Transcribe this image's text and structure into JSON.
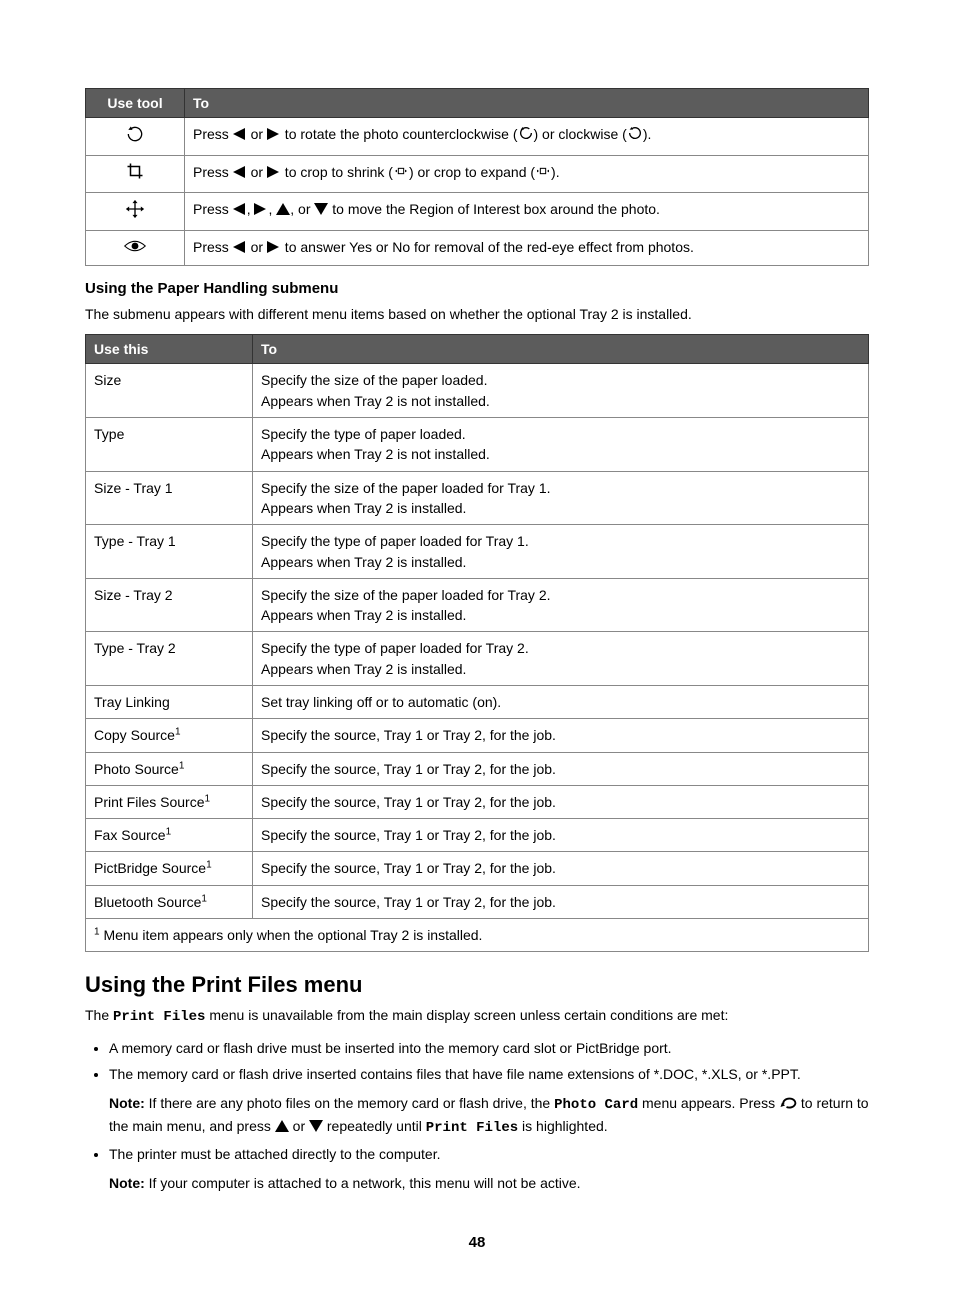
{
  "table1": {
    "head": {
      "tool": "Use tool",
      "to": "To"
    },
    "rows": [
      {
        "icon": "rotate-icon",
        "pre": "Press ",
        "mid1": " or ",
        "text1": " to rotate the photo counterclockwise (",
        "text2": ") or clockwise (",
        "text3": ")."
      },
      {
        "icon": "crop-icon",
        "pre": "Press ",
        "mid1": " or ",
        "text1": " to crop to shrink (",
        "text2": ") or crop to expand (",
        "text3": ")."
      },
      {
        "icon": "move-icon",
        "pre": "Press ",
        "c1": ", ",
        "c2": ", ",
        "c3": ", or ",
        "text1": " to move the Region of Interest box around the photo."
      },
      {
        "icon": "redeye-icon",
        "pre": "Press ",
        "mid1": " or ",
        "text1": " to answer Yes or No for removal of the red-eye effect from photos."
      }
    ]
  },
  "subheading": "Using the Paper Handling submenu",
  "subpara": "The submenu appears with different menu items based on whether the optional Tray 2 is installed.",
  "table2": {
    "head": {
      "usethis": "Use this",
      "to": "To"
    },
    "rows": [
      {
        "name": "Size",
        "sup": "",
        "to": "Specify the size of the paper loaded.\nAppears when Tray 2 is not installed."
      },
      {
        "name": "Type",
        "sup": "",
        "to": "Specify the type of paper loaded.\nAppears when Tray 2 is not installed."
      },
      {
        "name": "Size - Tray 1",
        "sup": "",
        "to": "Specify the size of the paper loaded for Tray 1.\nAppears when Tray 2 is installed."
      },
      {
        "name": "Type - Tray 1",
        "sup": "",
        "to": "Specify the type of paper loaded for Tray 1.\nAppears when Tray 2 is installed."
      },
      {
        "name": "Size - Tray 2",
        "sup": "",
        "to": "Specify the size of the paper loaded for Tray 2.\nAppears when Tray 2 is installed."
      },
      {
        "name": "Type - Tray 2",
        "sup": "",
        "to": "Specify the type of paper loaded for Tray 2.\nAppears when Tray 2 is installed."
      },
      {
        "name": "Tray Linking",
        "sup": "",
        "to": "Set tray linking off or to automatic (on)."
      },
      {
        "name": "Copy Source",
        "sup": "1",
        "to": "Specify the source, Tray 1 or Tray 2, for the job."
      },
      {
        "name": "Photo Source",
        "sup": "1",
        "to": "Specify the source, Tray 1 or Tray 2, for the job."
      },
      {
        "name": "Print Files Source",
        "sup": "1",
        "to": "Specify the source, Tray 1 or Tray 2, for the job."
      },
      {
        "name": "Fax Source",
        "sup": "1",
        "to": "Specify the source, Tray 1 or Tray 2, for the job."
      },
      {
        "name": "PictBridge Source",
        "sup": "1",
        "to": "Specify the source, Tray 1 or Tray 2, for the job."
      },
      {
        "name": "Bluetooth Source",
        "sup": "1",
        "to": "Specify the source, Tray 1 or Tray 2, for the job."
      }
    ],
    "footnote_sup": "1",
    "footnote": " Menu item appears only when the optional Tray 2 is installed."
  },
  "h2": "Using the Print Files menu",
  "intro_pre": "The ",
  "intro_mono": "Print Files",
  "intro_post": " menu is unavailable from the main display screen unless certain conditions are met:",
  "bullets": {
    "b1": "A memory card or flash drive must be inserted into the memory card slot or PictBridge port.",
    "b2": "The memory card or flash drive inserted contains files that have file name extensions of *.DOC, *.XLS, or *.PPT.",
    "note1_label": "Note: ",
    "note1_a": "If there are any photo files on the memory card or flash drive, the ",
    "note1_mono": "Photo Card",
    "note1_b": " menu appears. Press ",
    "note1_c": " to return to the main menu, and press ",
    "note1_d": " or ",
    "note1_e": " repeatedly until ",
    "note1_mono2": "Print Files",
    "note1_f": " is highlighted.",
    "b3": "The printer must be attached directly to the computer.",
    "note2_label": "Note:",
    "note2_text": " If your computer is attached to a network, this menu will not be active."
  },
  "pagenum": "48"
}
